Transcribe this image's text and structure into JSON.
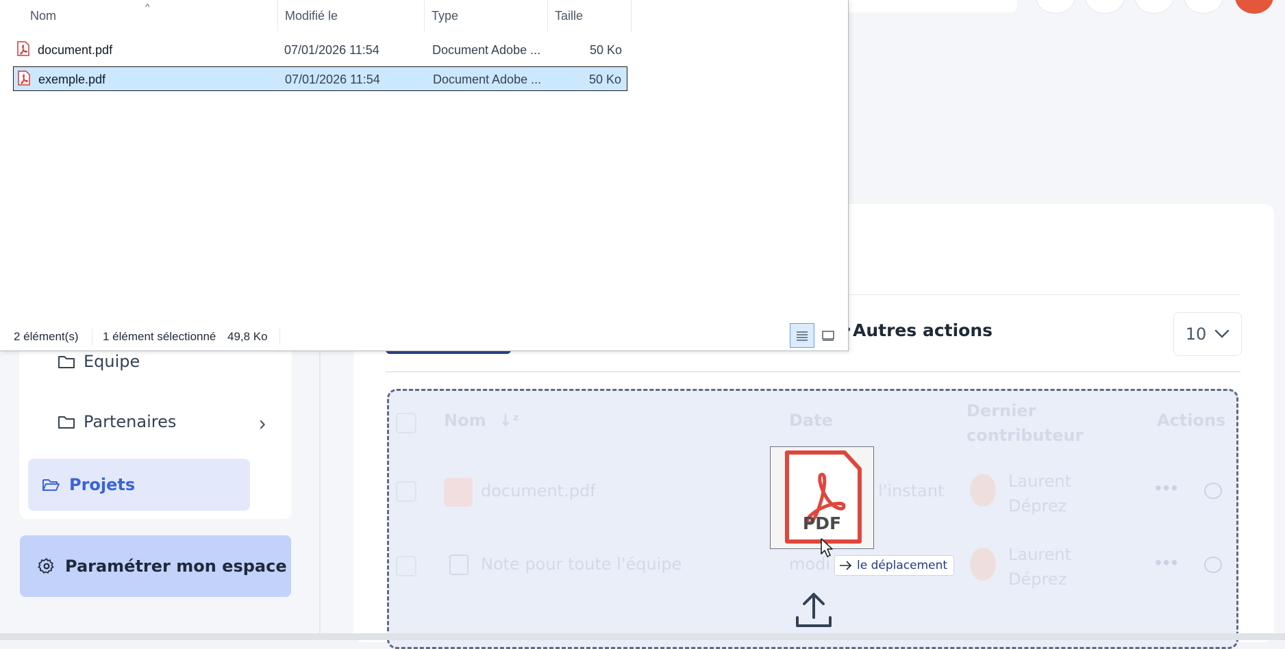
{
  "sidebar": {
    "folders": [
      {
        "label": "Equipe"
      },
      {
        "label": "Partenaires"
      }
    ],
    "active_folder": {
      "label": "Projets"
    },
    "settings_button": {
      "label": "Paramétrer mon espace"
    }
  },
  "toolbar": {
    "other_actions_label": "Autres actions",
    "per_page_value": "10"
  },
  "table": {
    "columns": [
      "Nom",
      "Date",
      "Dernier contributeur",
      "Actions"
    ],
    "contributor_col_line1": "Dernier",
    "contributor_col_line2": "contributeur",
    "rows": [
      {
        "name": "document.pdf",
        "date": "À l'instant",
        "contributor_first": "Laurent",
        "contributor_last": "Déprez"
      },
      {
        "name": "Note pour toute l'équipe",
        "date": "modi",
        "contributor_first": "Laurent",
        "contributor_last": "Déprez"
      }
    ]
  },
  "drag": {
    "pdf_label": "PDF",
    "tooltip": "le déplacement"
  },
  "dialog": {
    "columns": {
      "name": "Nom",
      "modified": "Modifié le",
      "type": "Type",
      "size": "Taille"
    },
    "files": [
      {
        "name": "document.pdf",
        "modified": "07/01/2026 11:54",
        "type": "Document Adobe ...",
        "size": "50 Ko",
        "selected": false
      },
      {
        "name": "exemple.pdf",
        "modified": "07/01/2026 11:54",
        "type": "Document Adobe ...",
        "size": "50 Ko",
        "selected": true
      }
    ],
    "status": {
      "count": "2 élément(s)",
      "selected": "1 élément sélectionné",
      "selected_size": "49,8 Ko"
    }
  },
  "colors": {
    "accent": "#3b63d6",
    "selection": "#cce8ff",
    "pdf_red": "#e0463c"
  },
  "icons": [
    "folder-icon",
    "folder-open-icon",
    "chevron-right-icon",
    "gear-icon",
    "chevron-down-icon",
    "pdf-file-icon",
    "note-icon",
    "more-icon",
    "comment-icon",
    "upload-icon",
    "arrow-right-icon",
    "details-view-icon",
    "preview-view-icon",
    "sort-icon"
  ]
}
